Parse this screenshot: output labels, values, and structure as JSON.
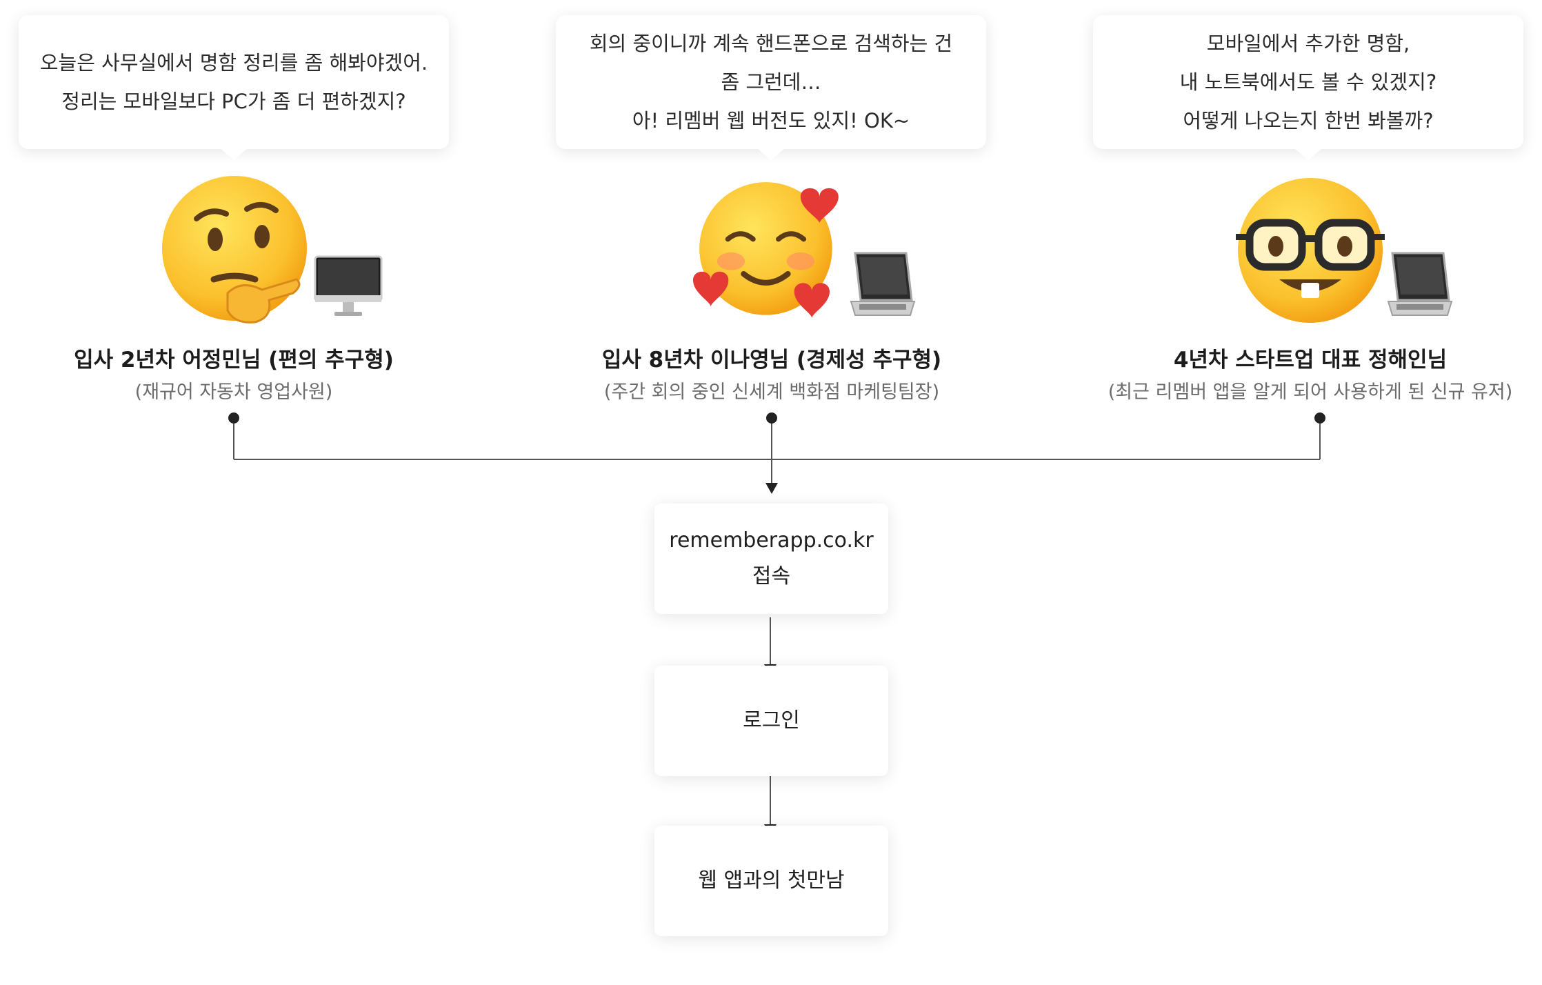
{
  "personas": [
    {
      "bubble": [
        "오늘은 사무실에서 명함 정리를 좀 해봐야겠어.",
        "정리는 모바일보다 PC가 좀 더 편하겠지?"
      ],
      "emoji": "thinking-face-icon",
      "device": "desktop-monitor-icon",
      "name": "입사 2년차 어정민님 (편의 추구형)",
      "role": "(재규어 자동차 영업사원)"
    },
    {
      "bubble": [
        "회의 중이니까 계속 핸드폰으로 검색하는 건",
        "좀 그런데…",
        "아! 리멤버 웹 버전도 있지! OK~"
      ],
      "emoji": "smiling-face-with-hearts-icon",
      "device": "laptop-icon",
      "name": "입사 8년차 이나영님 (경제성 추구형)",
      "role": "(주간 회의 중인 신세계 백화점 마케팅팀장)"
    },
    {
      "bubble": [
        "모바일에서 추가한 명함,",
        "내 노트북에서도 볼 수 있겠지?",
        "어떻게 나오는지 한번 봐볼까?"
      ],
      "emoji": "nerd-face-icon",
      "device": "laptop-icon",
      "name": "4년차 스타트업 대표 정해인님",
      "role": "(최근 리멤버 앱을 알게 되어 사용하게 된 신규 유저)"
    }
  ],
  "flow": {
    "step1": [
      "rememberapp.co.kr",
      "접속"
    ],
    "step2": "로그인",
    "step3": "웹 앱과의 첫만남"
  }
}
